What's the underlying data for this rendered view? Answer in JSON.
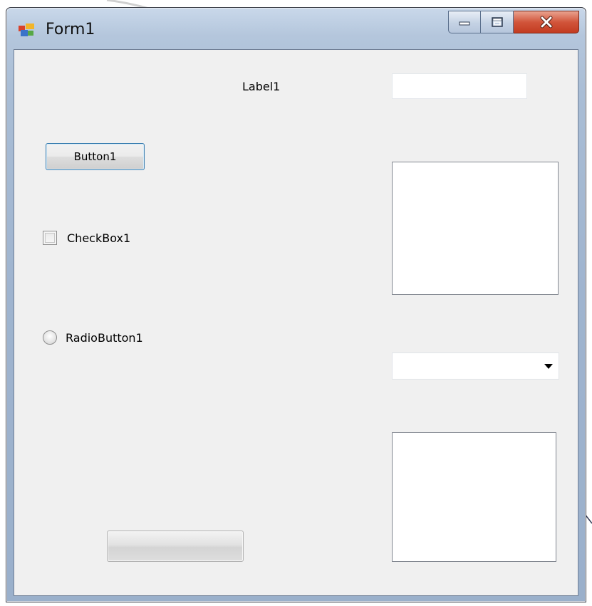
{
  "window": {
    "title": "Form1",
    "icon": "form-app-icon",
    "caption_buttons": [
      "minimize-icon",
      "maximize-icon",
      "close-icon"
    ],
    "close_color": "#c23b20"
  },
  "form": {
    "label1": "Label1",
    "textbox1": {
      "value": ""
    },
    "button1": "Button1",
    "checkbox1": {
      "label": "CheckBox1",
      "checked": false
    },
    "radiobutton1": {
      "label": "RadioButton1",
      "selected": false
    },
    "combobox1": {
      "selected": ""
    },
    "progressbar1": {
      "value": 0
    }
  },
  "colors": {
    "client_background": "#f0f0f0",
    "button_focus_border": "#3c7fb1",
    "frame_tint": "#a9bdd5"
  }
}
